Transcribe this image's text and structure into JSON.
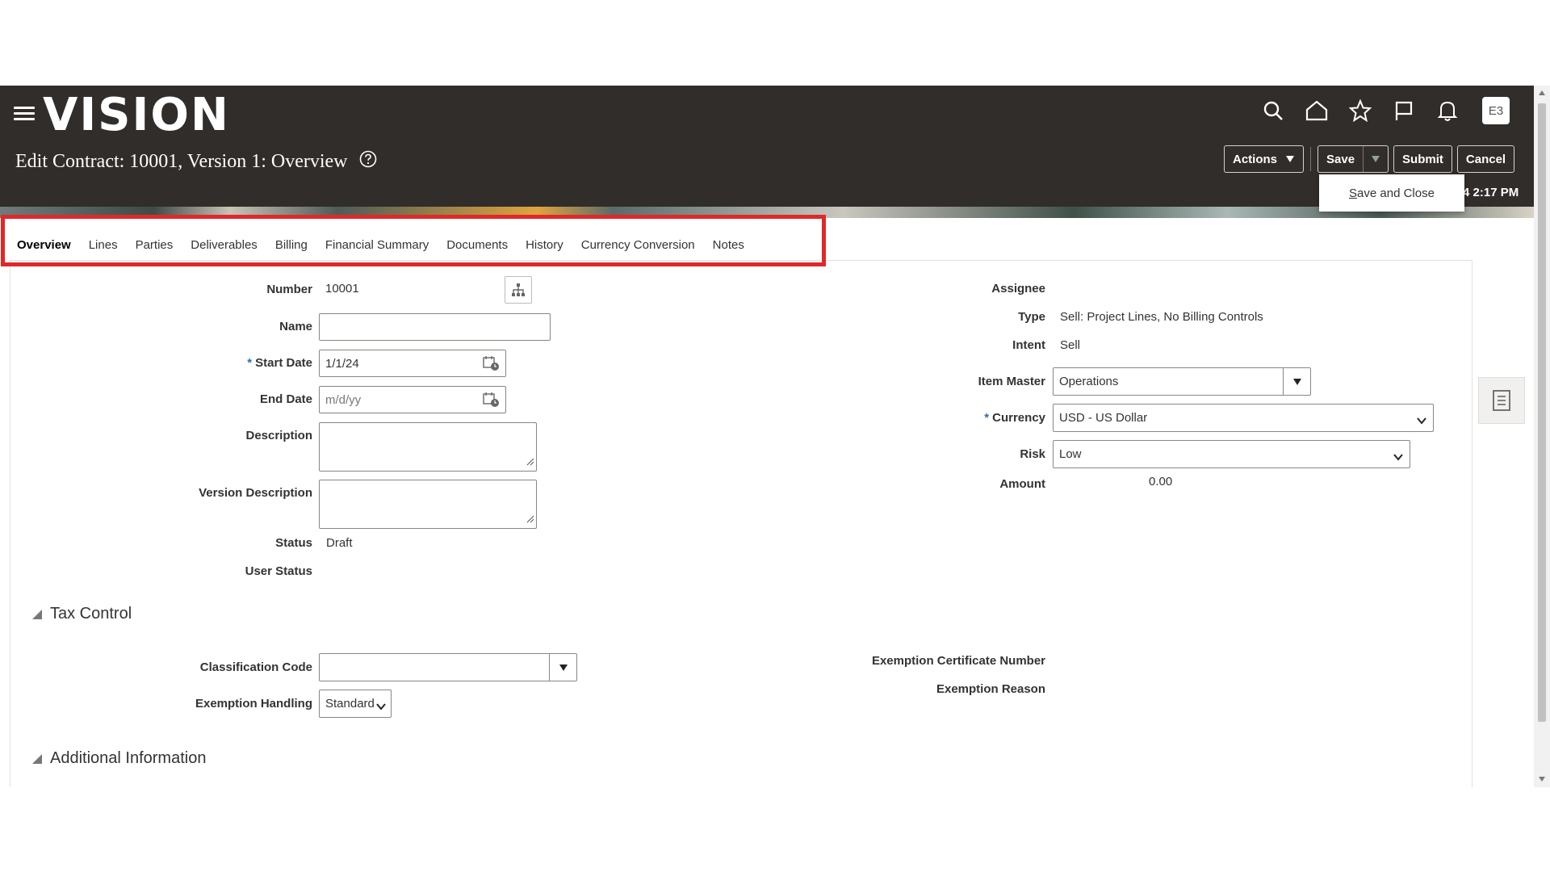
{
  "header": {
    "logo": "VISION",
    "page_title": "Edit Contract: 10001, Version 1: Overview",
    "avatar": "E3",
    "icons": [
      "search-icon",
      "home-icon",
      "star-icon",
      "flag-icon",
      "bell-icon"
    ],
    "buttons": {
      "actions": "Actions",
      "save": "Save",
      "submit": "Submit",
      "cancel": "Cancel"
    },
    "save_menu_item": "Save and Close",
    "save_menu_accelerator": "S",
    "save_menu_rest": "ave and Close",
    "time": "2:17 PM"
  },
  "tabs": [
    "Overview",
    "Lines",
    "Parties",
    "Deliverables",
    "Billing",
    "Financial Summary",
    "Documents",
    "History",
    "Currency Conversion",
    "Notes"
  ],
  "active_tab": "Overview",
  "left_form": {
    "number_label": "Number",
    "number_value": "10001",
    "name_label": "Name",
    "name_value": "",
    "start_date_label": "Start Date",
    "start_date_value": "1/1/24",
    "end_date_label": "End Date",
    "end_date_placeholder": "m/d/yy",
    "description_label": "Description",
    "version_description_label": "Version Description",
    "status_label": "Status",
    "status_value": "Draft",
    "user_status_label": "User Status",
    "required_mark": "*"
  },
  "right_form": {
    "assignee_label": "Assignee",
    "type_label": "Type",
    "type_value": "Sell: Project Lines, No Billing Controls",
    "intent_label": "Intent",
    "intent_value": "Sell",
    "item_master_label": "Item Master",
    "item_master_value": "Operations",
    "currency_label": "Currency",
    "currency_value": "USD - US Dollar",
    "risk_label": "Risk",
    "risk_value": "Low",
    "amount_label": "Amount",
    "amount_value": "0.00"
  },
  "tax_control": {
    "title": "Tax Control",
    "classification_code_label": "Classification Code",
    "exemption_handling_label": "Exemption Handling",
    "exemption_handling_value": "Standard",
    "exemption_certificate_label": "Exemption Certificate Number",
    "exemption_reason_label": "Exemption Reason"
  },
  "additional_info": {
    "title": "Additional Information"
  },
  "colors": {
    "header_bg": "#312d2a",
    "highlight": "#e0282a"
  }
}
